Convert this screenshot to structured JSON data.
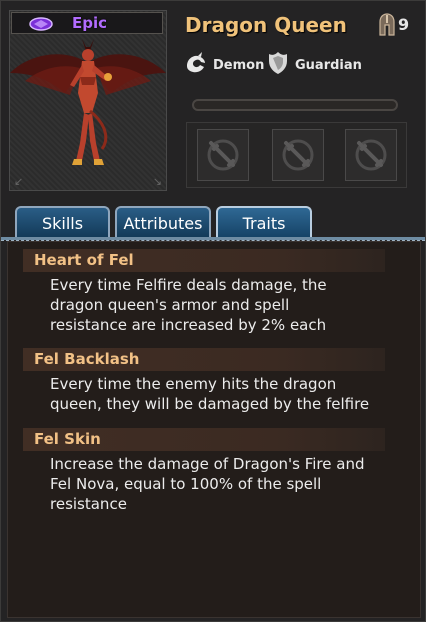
{
  "hero": {
    "name": "Dragon Queen",
    "rarity": "Epic",
    "level": "9",
    "tags": [
      {
        "label": "Demon",
        "icon": "demon-dragon-icon"
      },
      {
        "label": "Guardian",
        "icon": "guardian-shield-icon"
      }
    ]
  },
  "colors": {
    "rarity": "#b26cff",
    "name": "#f0c27a",
    "tab_bg": "#1e4a6f",
    "trait_title": "#f2c186"
  },
  "equipment_slots": [
    {
      "icon": "locked-sword-icon"
    },
    {
      "icon": "locked-sword-icon"
    },
    {
      "icon": "locked-sword-icon"
    }
  ],
  "tabs": [
    {
      "label": "Skills"
    },
    {
      "label": "Attributes"
    },
    {
      "label": "Traits",
      "active": true
    }
  ],
  "traits": [
    {
      "title": "Heart of Fel",
      "lines": [
        "Every time Felfire deals damage, the",
        "dragon queen's armor and spell",
        "resistance are increased by 2% each"
      ]
    },
    {
      "title": "Fel Backlash",
      "lines": [
        "Every time the enemy hits the dragon",
        "queen, they will be damaged by the felfire"
      ]
    },
    {
      "title": "Fel Skin",
      "lines": [
        "Increase the damage of Dragon's Fire and",
        "Fel Nova, equal to 100% of the spell",
        "resistance"
      ]
    }
  ]
}
